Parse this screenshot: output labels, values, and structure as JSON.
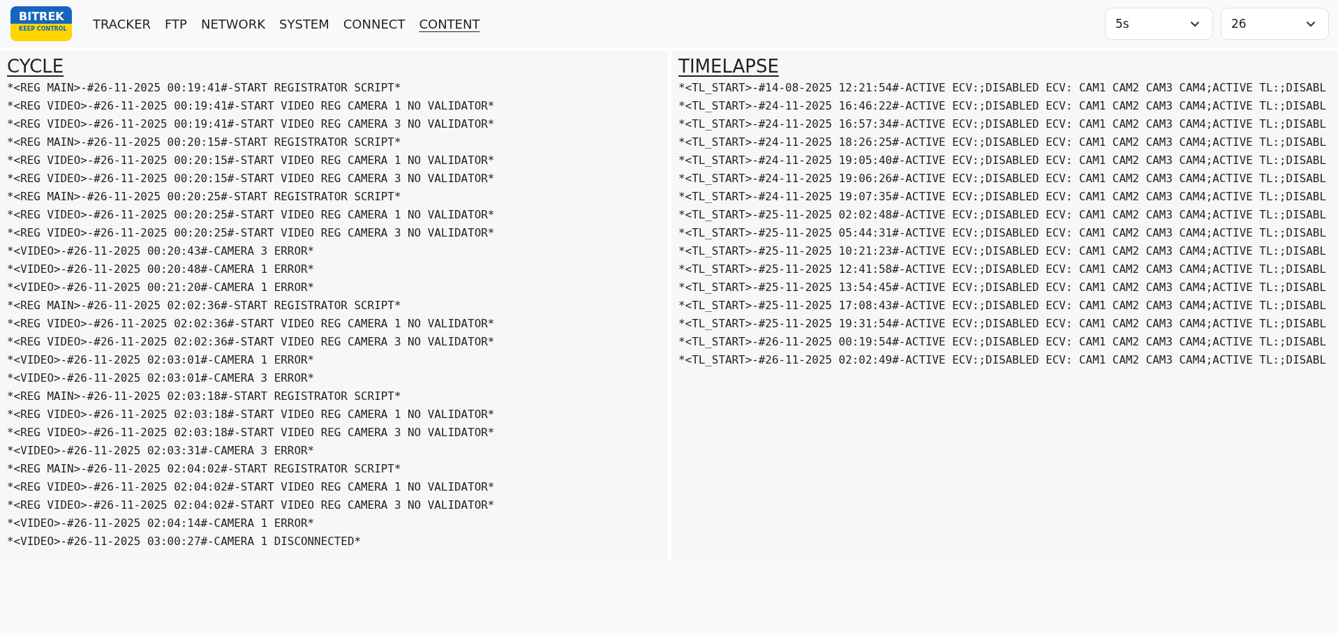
{
  "logo": {
    "brand": "BITREK",
    "tagline": "KEEP CONTROL"
  },
  "nav": [
    {
      "label": "TRACKER",
      "selected": false
    },
    {
      "label": "FTP",
      "selected": false
    },
    {
      "label": "NETWORK",
      "selected": false
    },
    {
      "label": "SYSTEM",
      "selected": false
    },
    {
      "label": "CONNECT",
      "selected": false
    },
    {
      "label": "CONTENT",
      "selected": true
    }
  ],
  "selects": [
    {
      "value": "5s"
    },
    {
      "value": "26"
    }
  ],
  "panels": [
    {
      "title": "CYCLE",
      "lines": [
        "*<REG MAIN>-#26-11-2025 00:19:41#-START REGISTRATOR SCRIPT*",
        "*<REG VIDEO>-#26-11-2025 00:19:41#-START VIDEO REG CAMERA 1 NO VALIDATOR*",
        "*<REG VIDEO>-#26-11-2025 00:19:41#-START VIDEO REG CAMERA 3 NO VALIDATOR*",
        "*<REG MAIN>-#26-11-2025 00:20:15#-START REGISTRATOR SCRIPT*",
        "*<REG VIDEO>-#26-11-2025 00:20:15#-START VIDEO REG CAMERA 1 NO VALIDATOR*",
        "*<REG VIDEO>-#26-11-2025 00:20:15#-START VIDEO REG CAMERA 3 NO VALIDATOR*",
        "*<REG MAIN>-#26-11-2025 00:20:25#-START REGISTRATOR SCRIPT*",
        "*<REG VIDEO>-#26-11-2025 00:20:25#-START VIDEO REG CAMERA 1 NO VALIDATOR*",
        "*<REG VIDEO>-#26-11-2025 00:20:25#-START VIDEO REG CAMERA 3 NO VALIDATOR*",
        "*<VIDEO>-#26-11-2025 00:20:43#-CAMERA 3 ERROR*",
        "*<VIDEO>-#26-11-2025 00:20:48#-CAMERA 1 ERROR*",
        "*<VIDEO>-#26-11-2025 00:21:20#-CAMERA 1 ERROR*",
        "*<REG MAIN>-#26-11-2025 02:02:36#-START REGISTRATOR SCRIPT*",
        "*<REG VIDEO>-#26-11-2025 02:02:36#-START VIDEO REG CAMERA 1 NO VALIDATOR*",
        "*<REG VIDEO>-#26-11-2025 02:02:36#-START VIDEO REG CAMERA 3 NO VALIDATOR*",
        "*<VIDEO>-#26-11-2025 02:03:01#-CAMERA 1 ERROR*",
        "*<VIDEO>-#26-11-2025 02:03:01#-CAMERA 3 ERROR*",
        "*<REG MAIN>-#26-11-2025 02:03:18#-START REGISTRATOR SCRIPT*",
        "*<REG VIDEO>-#26-11-2025 02:03:18#-START VIDEO REG CAMERA 1 NO VALIDATOR*",
        "*<REG VIDEO>-#26-11-2025 02:03:18#-START VIDEO REG CAMERA 3 NO VALIDATOR*",
        "*<VIDEO>-#26-11-2025 02:03:31#-CAMERA 3 ERROR*",
        "*<REG MAIN>-#26-11-2025 02:04:02#-START REGISTRATOR SCRIPT*",
        "*<REG VIDEO>-#26-11-2025 02:04:02#-START VIDEO REG CAMERA 1 NO VALIDATOR*",
        "*<REG VIDEO>-#26-11-2025 02:04:02#-START VIDEO REG CAMERA 3 NO VALIDATOR*",
        "*<VIDEO>-#26-11-2025 02:04:14#-CAMERA 1 ERROR*",
        "*<VIDEO>-#26-11-2025 03:00:27#-CAMERA 1 DISCONNECTED*"
      ]
    },
    {
      "title": "TIMELAPSE",
      "lines": [
        "*<TL_START>-#14-08-2025 12:21:54#-ACTIVE ECV:;DISABLED ECV: CAM1 CAM2 CAM3 CAM4;ACTIVE TL:;DISABL",
        "*<TL_START>-#24-11-2025 16:46:22#-ACTIVE ECV:;DISABLED ECV: CAM1 CAM2 CAM3 CAM4;ACTIVE TL:;DISABL",
        "*<TL_START>-#24-11-2025 16:57:34#-ACTIVE ECV:;DISABLED ECV: CAM1 CAM2 CAM3 CAM4;ACTIVE TL:;DISABL",
        "*<TL_START>-#24-11-2025 18:26:25#-ACTIVE ECV:;DISABLED ECV: CAM1 CAM2 CAM3 CAM4;ACTIVE TL:;DISABL",
        "*<TL_START>-#24-11-2025 19:05:40#-ACTIVE ECV:;DISABLED ECV: CAM1 CAM2 CAM3 CAM4;ACTIVE TL:;DISABL",
        "*<TL_START>-#24-11-2025 19:06:26#-ACTIVE ECV:;DISABLED ECV: CAM1 CAM2 CAM3 CAM4;ACTIVE TL:;DISABL",
        "*<TL_START>-#24-11-2025 19:07:35#-ACTIVE ECV:;DISABLED ECV: CAM1 CAM2 CAM3 CAM4;ACTIVE TL:;DISABL",
        "*<TL_START>-#25-11-2025 02:02:48#-ACTIVE ECV:;DISABLED ECV: CAM1 CAM2 CAM3 CAM4;ACTIVE TL:;DISABL",
        "*<TL_START>-#25-11-2025 05:44:31#-ACTIVE ECV:;DISABLED ECV: CAM1 CAM2 CAM3 CAM4;ACTIVE TL:;DISABL",
        "*<TL_START>-#25-11-2025 10:21:23#-ACTIVE ECV:;DISABLED ECV: CAM1 CAM2 CAM3 CAM4;ACTIVE TL:;DISABL",
        "*<TL_START>-#25-11-2025 12:41:58#-ACTIVE ECV:;DISABLED ECV: CAM1 CAM2 CAM3 CAM4;ACTIVE TL:;DISABL",
        "*<TL_START>-#25-11-2025 13:54:45#-ACTIVE ECV:;DISABLED ECV: CAM1 CAM2 CAM3 CAM4;ACTIVE TL:;DISABL",
        "*<TL_START>-#25-11-2025 17:08:43#-ACTIVE ECV:;DISABLED ECV: CAM1 CAM2 CAM3 CAM4;ACTIVE TL:;DISABL",
        "*<TL_START>-#25-11-2025 19:31:54#-ACTIVE ECV:;DISABLED ECV: CAM1 CAM2 CAM3 CAM4;ACTIVE TL:;DISABL",
        "*<TL_START>-#26-11-2025 00:19:54#-ACTIVE ECV:;DISABLED ECV: CAM1 CAM2 CAM3 CAM4;ACTIVE TL:;DISABL",
        "*<TL_START>-#26-11-2025 02:02:49#-ACTIVE ECV:;DISABLED ECV: CAM1 CAM2 CAM3 CAM4;ACTIVE TL:;DISABL"
      ]
    }
  ]
}
